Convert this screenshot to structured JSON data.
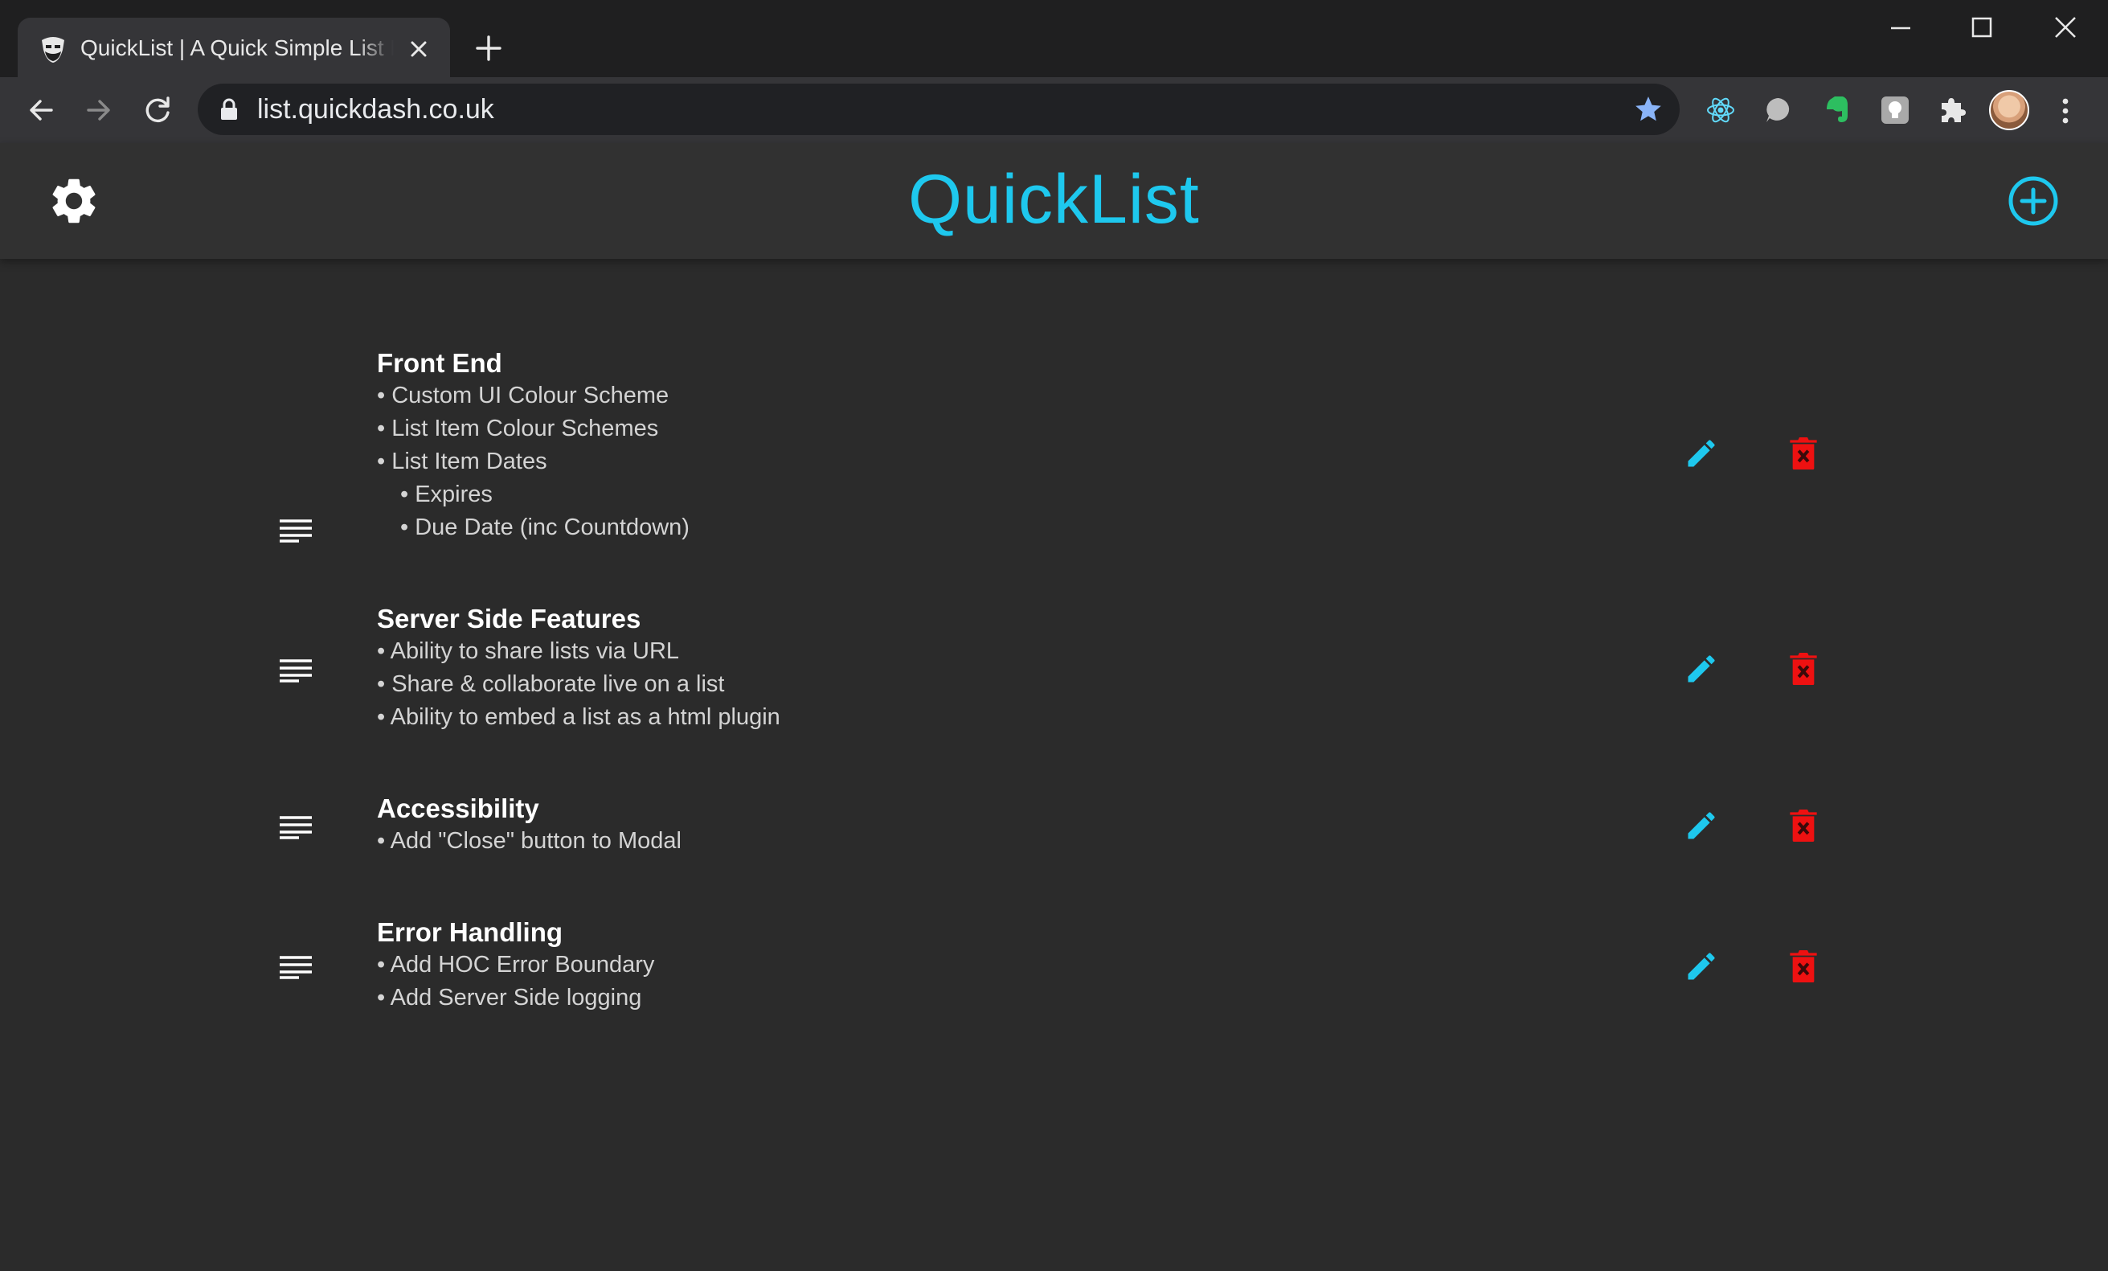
{
  "browser": {
    "tab_title": "QuickList | A Quick Simple List Manager",
    "url": "list.quickdash.co.uk",
    "colors": {
      "tab_bg": "#353538",
      "strip_bg": "#1f1f20",
      "bookmark_star": "#8ab4f8"
    },
    "extensions": [
      "react-devtools-icon",
      "speech-bubble-icon",
      "evernote-icon",
      "lightbulb-extension-icon",
      "puzzle-extensions-icon"
    ]
  },
  "app": {
    "title": "QuickList",
    "colors": {
      "accent": "#1ec8ee",
      "danger": "#ee1111",
      "background": "#2b2b2b",
      "header": "#313131"
    },
    "lists": [
      {
        "title": "Front End",
        "items": [
          {
            "text": "• Custom UI Colour Scheme",
            "level": 0
          },
          {
            "text": "• List Item Colour Schemes",
            "level": 0
          },
          {
            "text": "• List Item Dates",
            "level": 0
          },
          {
            "text": "• Expires",
            "level": 1
          },
          {
            "text": "• Due Date (inc Countdown)",
            "level": 1
          }
        ]
      },
      {
        "title": "Server Side Features",
        "items": [
          {
            "text": "• Ability to share lists via URL",
            "level": 0
          },
          {
            "text": "• Share & collaborate live on a list",
            "level": 0
          },
          {
            "text": "• Ability to embed a list as a html plugin",
            "level": 0
          }
        ]
      },
      {
        "title": "Accessibility",
        "items": [
          {
            "text": "• Add \"Close\" button to Modal",
            "level": 0
          }
        ]
      },
      {
        "title": "Error Handling",
        "items": [
          {
            "text": "• Add HOC Error Boundary",
            "level": 0
          },
          {
            "text": "• Add Server Side logging",
            "level": 0
          }
        ]
      }
    ]
  }
}
